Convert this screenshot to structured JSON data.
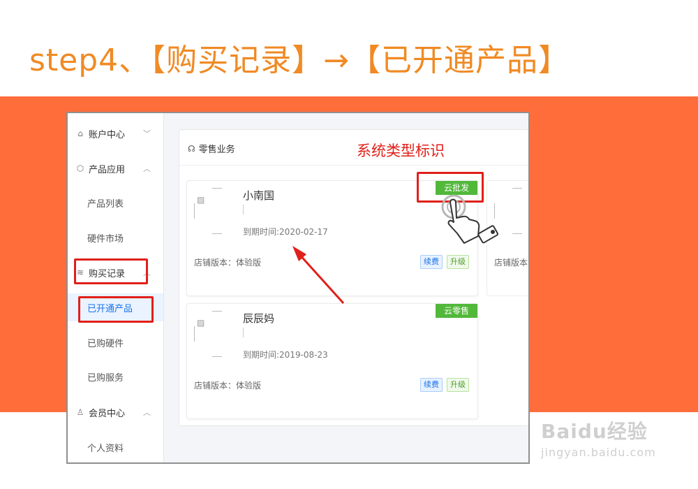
{
  "header": {
    "title": "step4、【购买记录】→【已开通产品】"
  },
  "colors": {
    "accent_orange": "#f08a24",
    "band": "#ff6d3b",
    "annotation_red": "#e0201a",
    "active_blue": "#1b73e8",
    "ribbon_green": "#52b83a"
  },
  "sidebar": {
    "groups": [
      {
        "label": "账户中心",
        "icon": "home-icon"
      },
      {
        "label": "产品应用",
        "icon": "cube-icon",
        "items": [
          "产品列表",
          "硬件市场"
        ]
      },
      {
        "label": "购买记录",
        "icon": "layers-icon",
        "items": [
          "已开通产品",
          "已购硬件",
          "已购服务"
        ]
      },
      {
        "label": "会员中心",
        "icon": "user-icon",
        "items": [
          "个人资料"
        ]
      }
    ],
    "active": "已开通产品"
  },
  "panel": {
    "title": "零售业务",
    "title_icon": "headset-icon"
  },
  "annotation": {
    "label": "系统类型标识"
  },
  "cards": [
    {
      "name": "小南国",
      "expire": "到期时间:2020-02-17",
      "version": "店铺版本：体验版",
      "type": "云批发",
      "tags": [
        "续费",
        "升级"
      ]
    },
    {
      "name": "辰辰妈",
      "expire": "到期时间:2019-08-23",
      "version": "店铺版本：体验版",
      "type": "云零售",
      "tags": [
        "续费",
        "升级"
      ]
    }
  ],
  "partial_card": {
    "version": "店铺版本"
  },
  "watermark": {
    "logo": "Baidu经验",
    "url": "jingyan.baidu.com"
  }
}
